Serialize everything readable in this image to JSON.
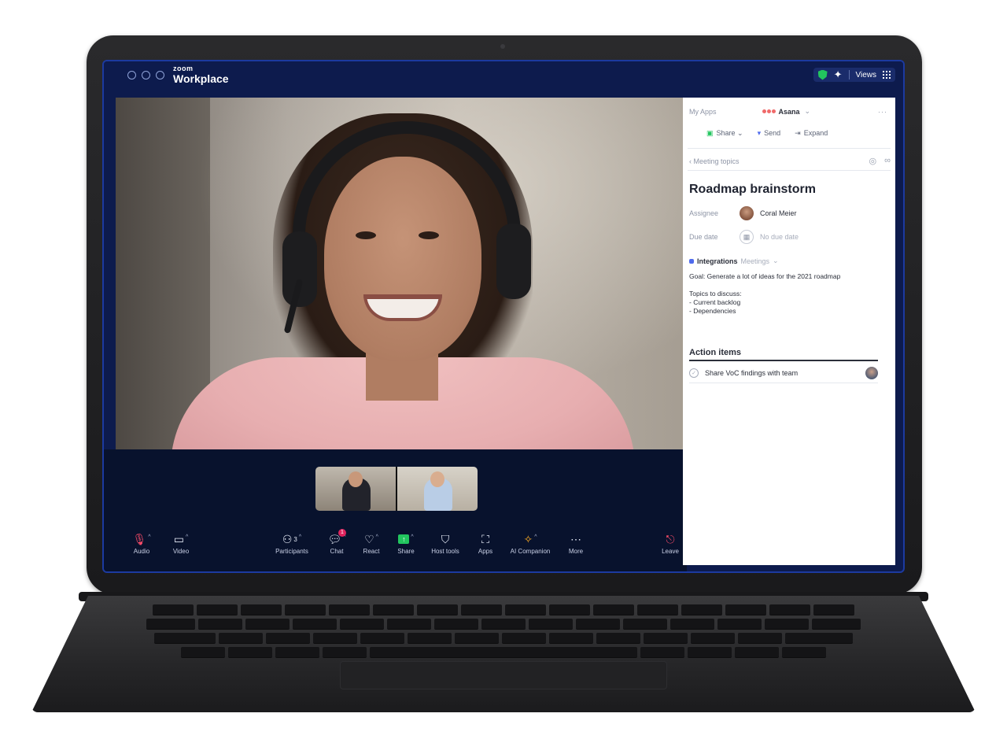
{
  "window": {
    "brand_small": "zoom",
    "brand_title": "Workplace",
    "views_label": "Views"
  },
  "toolbar": {
    "audio": "Audio",
    "video": "Video",
    "participants": "Participants",
    "participants_count": "3",
    "chat": "Chat",
    "chat_badge": "1",
    "react": "React",
    "share": "Share",
    "host_tools": "Host tools",
    "apps": "Apps",
    "ai_companion": "AI Companion",
    "more": "More",
    "leave": "Leave"
  },
  "panel": {
    "my_apps": "My Apps",
    "app_name": "Asana",
    "actions": {
      "share": "Share",
      "send": "Send",
      "expand": "Expand"
    },
    "breadcrumb": "Meeting topics",
    "task_title": "Roadmap brainstorm",
    "assignee_label": "Assignee",
    "assignee_name": "Coral Meier",
    "due_label": "Due date",
    "due_value": "No due date",
    "project_name": "Integrations",
    "project_section": "Meetings",
    "description": "Goal: Generate a lot of ideas for the 2021 roadmap\n\nTopics to discuss:\n- Current backlog\n- Dependencies",
    "action_items_heading": "Action items",
    "action_item": "Share VoC findings with team"
  },
  "colors": {
    "window_bg": "#0d1b4d",
    "accent_green": "#22c55e",
    "badge_red": "#e0245e",
    "asana_coral": "#f06a6a"
  },
  "icons": [
    "shield-icon",
    "sparkle-icon",
    "grid-icon",
    "mic-muted-icon",
    "camera-icon",
    "participants-icon",
    "chat-icon",
    "heart-icon",
    "share-screen-icon",
    "host-shield-icon",
    "apps-icon",
    "sparkle-ai-icon",
    "more-icon",
    "leave-icon",
    "asana-logo-icon",
    "chevron-down-icon",
    "calendar-icon",
    "check-circle-icon",
    "link-icon",
    "back-chevron-icon"
  ]
}
